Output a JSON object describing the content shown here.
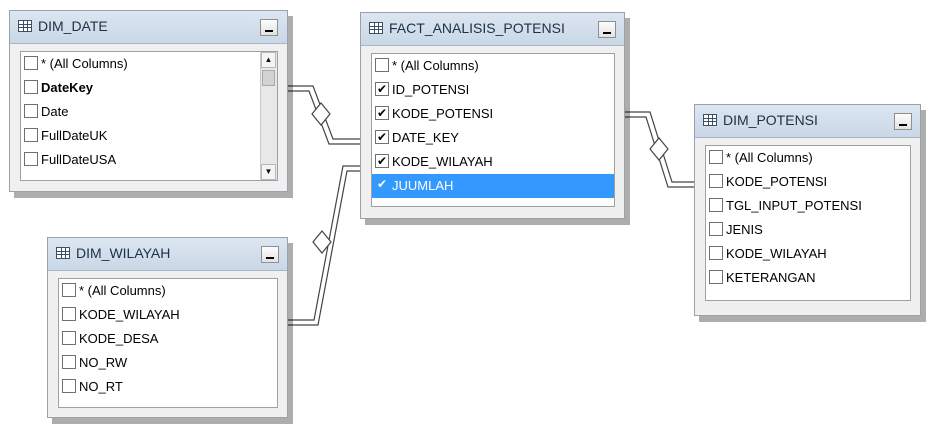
{
  "tables": {
    "dim_date": {
      "title": "DIM_DATE",
      "columns": [
        {
          "label": "* (All Columns)",
          "checked": false
        },
        {
          "label": "DateKey",
          "checked": false,
          "bold": true
        },
        {
          "label": "Date",
          "checked": false
        },
        {
          "label": "FullDateUK",
          "checked": false
        },
        {
          "label": "FullDateUSA",
          "checked": false
        }
      ]
    },
    "fact_analisis_potensi": {
      "title": "FACT_ANALISIS_POTENSI",
      "columns": [
        {
          "label": "* (All Columns)",
          "checked": false
        },
        {
          "label": "ID_POTENSI",
          "checked": true
        },
        {
          "label": "KODE_POTENSI",
          "checked": true
        },
        {
          "label": "DATE_KEY",
          "checked": true
        },
        {
          "label": "KODE_WILAYAH",
          "checked": true
        },
        {
          "label": "JUUMLAH",
          "checked": true,
          "selected": true
        }
      ]
    },
    "dim_potensi": {
      "title": "DIM_POTENSI",
      "columns": [
        {
          "label": "* (All Columns)",
          "checked": false
        },
        {
          "label": "KODE_POTENSI",
          "checked": false
        },
        {
          "label": "TGL_INPUT_POTENSI",
          "checked": false
        },
        {
          "label": "JENIS",
          "checked": false
        },
        {
          "label": "KODE_WILAYAH",
          "checked": false
        },
        {
          "label": "KETERANGAN",
          "checked": false
        }
      ]
    },
    "dim_wilayah": {
      "title": "DIM_WILAYAH",
      "columns": [
        {
          "label": "* (All Columns)",
          "checked": false
        },
        {
          "label": "KODE_WILAYAH",
          "checked": false
        },
        {
          "label": "KODE_DESA",
          "checked": false
        },
        {
          "label": "NO_RW",
          "checked": false
        },
        {
          "label": "NO_RT",
          "checked": false
        }
      ]
    }
  },
  "icons": {
    "table": "table-grid-icon",
    "minimize": "minimize-icon",
    "checkbox": "checkbox-icon",
    "scroll_up": "scroll-up-arrow-icon",
    "scroll_down": "scroll-down-arrow-icon"
  },
  "colors": {
    "title_bar": "#d3dfeb",
    "selection": "#3399ff",
    "panel": "#f0f0f0",
    "connector": "#444444"
  }
}
